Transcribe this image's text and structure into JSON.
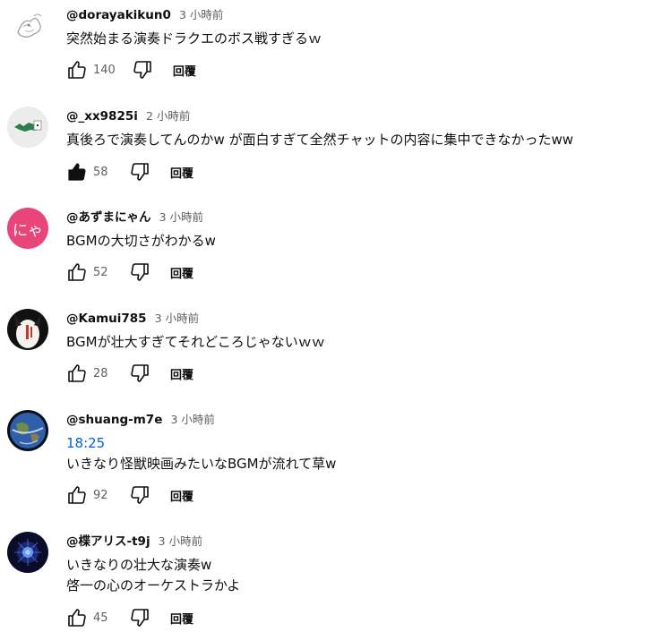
{
  "comments": [
    {
      "author": "@dorayakikun0",
      "time": "3 小時前",
      "timestamp_link": "",
      "lines": [
        "突然始まる演奏ドラクエのボス戦すぎるｗ"
      ],
      "likes": "140",
      "liked": false,
      "reply_label": "回覆",
      "avatar": "sketch-avatar"
    },
    {
      "author": "@_xx9825i",
      "time": "2 小時前",
      "timestamp_link": "",
      "lines": [
        "真後ろで演奏してんのかw が面白すぎて全然チャットの内容に集中できなかったww"
      ],
      "likes": "58",
      "liked": true,
      "reply_label": "回覆",
      "avatar": "green-creature-avatar"
    },
    {
      "author": "@あずまにゃん",
      "time": "3 小時前",
      "timestamp_link": "",
      "lines": [
        "BGMの大切さがわかるw"
      ],
      "likes": "52",
      "liked": false,
      "reply_label": "回覆",
      "avatar": "nya-text-avatar",
      "avatar_text": "にゃ",
      "avatar_color": "#e8457a"
    },
    {
      "author": "@Kamui785",
      "time": "3 小時前",
      "timestamp_link": "",
      "lines": [
        "BGMが壮大すぎてそれどころじゃないｗｗ"
      ],
      "likes": "28",
      "liked": false,
      "reply_label": "回覆",
      "avatar": "character-avatar"
    },
    {
      "author": "@shuang-m7e",
      "time": "3 小時前",
      "timestamp_link": "18:25",
      "lines": [
        "いきなり怪獣映画みたいなBGMが流れて草w"
      ],
      "likes": "92",
      "liked": false,
      "reply_label": "回覆",
      "avatar": "earth-avatar"
    },
    {
      "author": "@楪アリス-t9j",
      "time": "3 小時前",
      "timestamp_link": "",
      "lines": [
        "いきなりの壮大な演奏w",
        "啓一の心のオーケストラかよ"
      ],
      "likes": "45",
      "liked": false,
      "reply_label": "回覆",
      "avatar": "galaxy-avatar"
    }
  ]
}
